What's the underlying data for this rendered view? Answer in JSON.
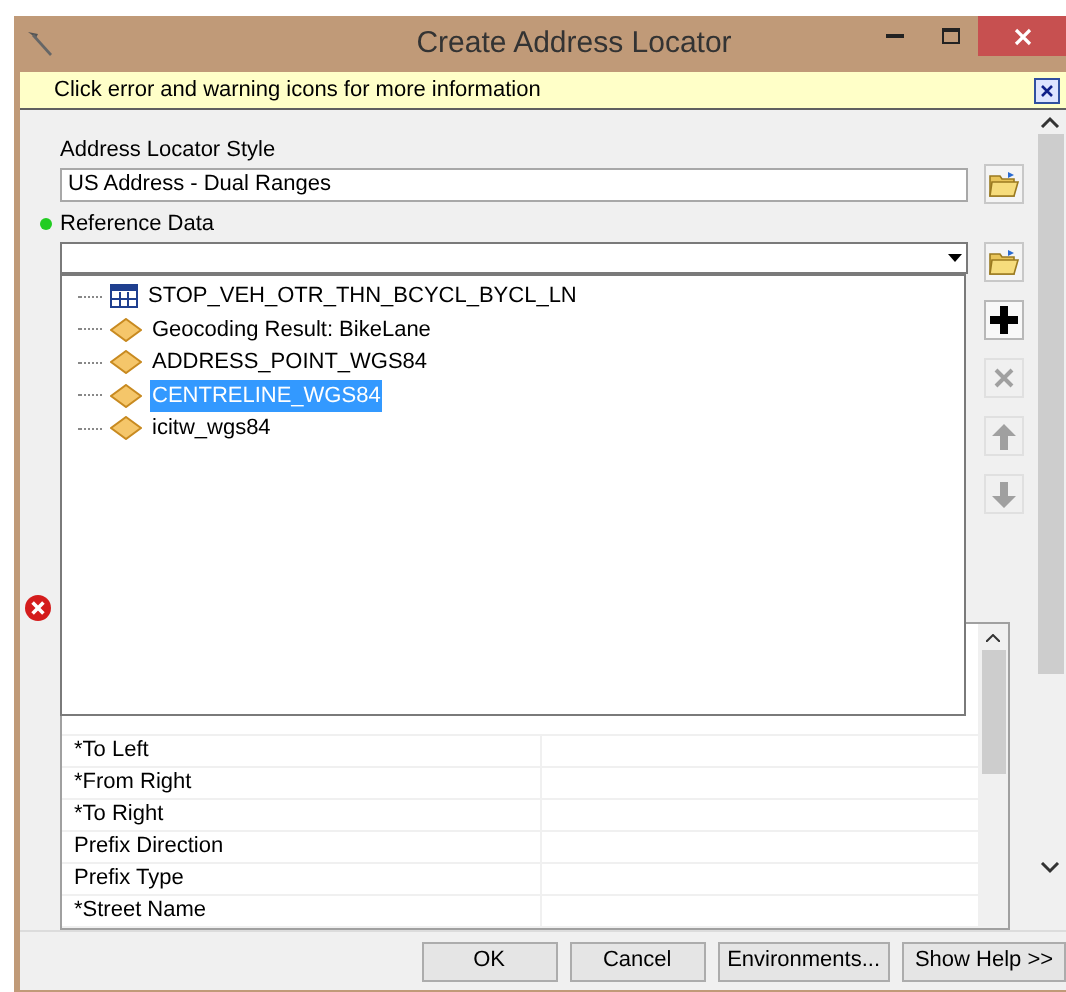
{
  "window": {
    "title": "Create Address Locator"
  },
  "message_bar": {
    "text": "Click error and warning icons for more information"
  },
  "address_locator_style": {
    "label": "Address Locator Style",
    "value": "US Address - Dual Ranges"
  },
  "reference_data": {
    "label": "Reference Data",
    "valid": true
  },
  "dropdown": {
    "items": [
      {
        "name": "STOP_VEH_OTR_THN_BCYCL_BYCL_LN",
        "kind": "table",
        "selected": false
      },
      {
        "name": "Geocoding Result: BikeLane",
        "kind": "feature",
        "selected": false
      },
      {
        "name": "ADDRESS_POINT_WGS84",
        "kind": "feature",
        "selected": false
      },
      {
        "name": "CENTRELINE_WGS84",
        "kind": "feature",
        "selected": true
      },
      {
        "name": "icitw_wgs84",
        "kind": "feature",
        "selected": false
      }
    ]
  },
  "tools": [
    {
      "kind": "add",
      "disabled": false
    },
    {
      "kind": "remove",
      "disabled": true
    },
    {
      "kind": "up",
      "disabled": true
    },
    {
      "kind": "down",
      "disabled": true
    }
  ],
  "field_map": {
    "error": true,
    "rows": [
      "*To Left",
      "*From Right",
      "*To Right",
      "Prefix Direction",
      "Prefix Type",
      "*Street Name"
    ]
  },
  "buttons": [
    "OK",
    "Cancel",
    "Environments...",
    "Show Help >>"
  ]
}
